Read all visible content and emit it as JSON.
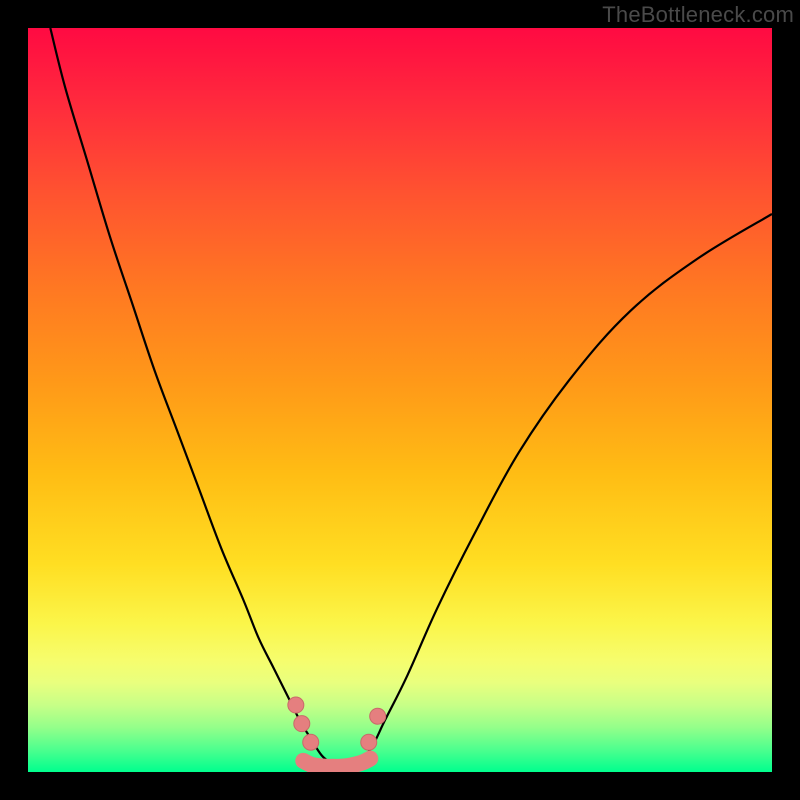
{
  "watermark": "TheBottleneck.com",
  "colors": {
    "background": "#000000",
    "gradient_top": "#ff0a42",
    "gradient_bottom": "#00ff8e",
    "curve": "#000000",
    "marker": "#e57f7f"
  },
  "chart_data": {
    "type": "line",
    "title": "",
    "xlabel": "",
    "ylabel": "",
    "xlim": [
      0,
      100
    ],
    "ylim": [
      0,
      100
    ],
    "grid": false,
    "legend": false,
    "series": [
      {
        "name": "left-curve",
        "x": [
          3,
          5,
          8,
          11,
          14,
          17,
          20,
          23,
          26,
          29,
          31,
          33,
          35,
          36.5,
          38,
          39.5,
          41
        ],
        "y": [
          100,
          92,
          82,
          72,
          63,
          54,
          46,
          38,
          30,
          23,
          18,
          14,
          10,
          7,
          4.5,
          2.2,
          1
        ]
      },
      {
        "name": "right-curve",
        "x": [
          44,
          46,
          48,
          51,
          55,
          60,
          66,
          73,
          81,
          90,
          100
        ],
        "y": [
          1,
          3,
          7,
          13,
          22,
          32,
          43,
          53,
          62,
          69,
          75
        ]
      },
      {
        "name": "floor-band",
        "x": [
          37,
          38,
          39,
          40,
          41,
          42,
          43,
          44,
          45,
          46
        ],
        "y": [
          1.5,
          1.0,
          0.8,
          0.7,
          0.7,
          0.7,
          0.8,
          1.0,
          1.3,
          1.8
        ]
      }
    ],
    "markers": [
      {
        "name": "left-upper",
        "x": 36.0,
        "y": 9.0
      },
      {
        "name": "left-upper2",
        "x": 36.8,
        "y": 6.5
      },
      {
        "name": "left-lower",
        "x": 38.0,
        "y": 4.0
      },
      {
        "name": "right-lower",
        "x": 45.8,
        "y": 4.0
      },
      {
        "name": "right-upper",
        "x": 47.0,
        "y": 7.5
      }
    ]
  }
}
